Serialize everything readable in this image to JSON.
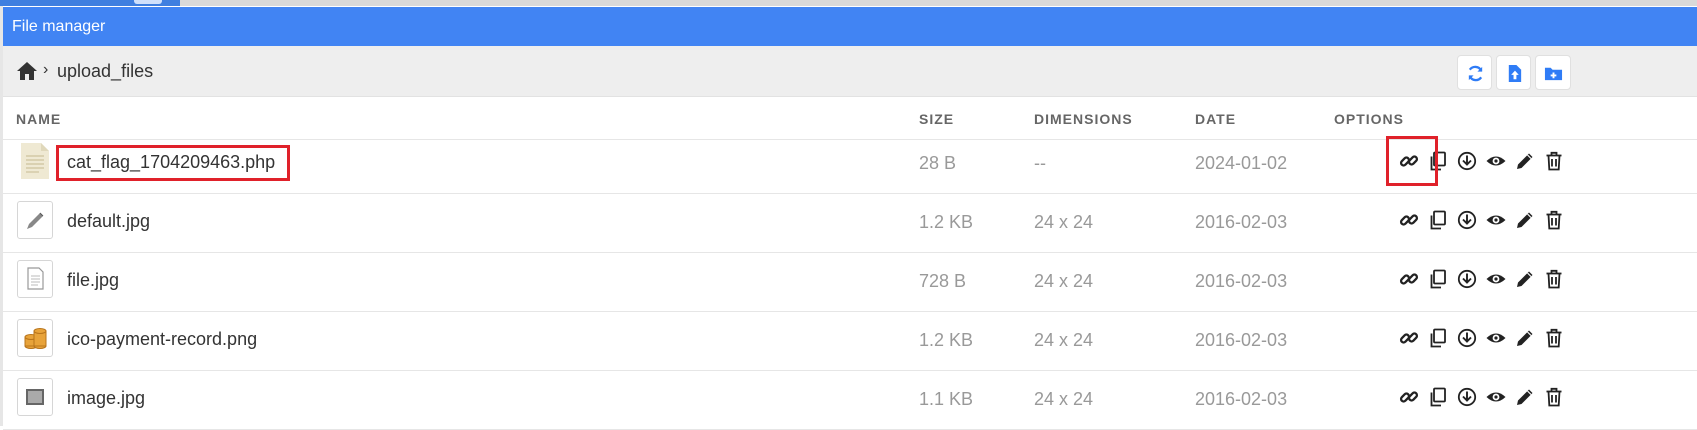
{
  "window": {
    "title": "File manager"
  },
  "breadcrumb": {
    "current": "upload_files",
    "separator": "›"
  },
  "toolbar": {
    "buttons": [
      {
        "name": "refresh",
        "icon": "refresh-icon"
      },
      {
        "name": "upload-file",
        "icon": "file-upload-icon"
      },
      {
        "name": "new-folder",
        "icon": "folder-plus-icon"
      }
    ]
  },
  "table": {
    "columns": {
      "name": "NAME",
      "size": "SIZE",
      "dimensions": "DIMENSIONS",
      "date": "DATE",
      "options": "OPTIONS"
    },
    "rows": [
      {
        "name": "cat_flag_1704209463.php",
        "size": "28 B",
        "dimensions": "--",
        "date": "2024-01-02",
        "thumb": "text-file-icon"
      },
      {
        "name": "default.jpg",
        "size": "1.2 KB",
        "dimensions": "24 x 24",
        "date": "2016-02-03",
        "thumb": "pencil-icon"
      },
      {
        "name": "file.jpg",
        "size": "728 B",
        "dimensions": "24 x 24",
        "date": "2016-02-03",
        "thumb": "document-icon"
      },
      {
        "name": "ico-payment-record.png",
        "size": "1.2 KB",
        "dimensions": "24 x 24",
        "date": "2016-02-03",
        "thumb": "coins-icon"
      },
      {
        "name": "image.jpg",
        "size": "1.1 KB",
        "dimensions": "24 x 24",
        "date": "2016-02-03",
        "thumb": "picture-icon"
      }
    ],
    "row_options": [
      "link-icon",
      "copy-icon",
      "download-icon",
      "eye-icon",
      "pencil-edit-icon",
      "trash-icon"
    ]
  },
  "colors": {
    "titlebar": "#4184f3",
    "highlight": "#e0212a",
    "path_bg": "#eeeeee"
  }
}
